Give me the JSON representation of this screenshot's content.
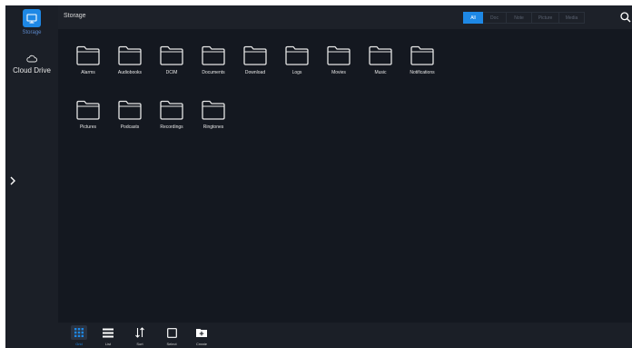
{
  "sidebar": {
    "items": [
      {
        "label": "Storage",
        "icon": "monitor-icon",
        "active": true
      },
      {
        "label": "Cloud Drive",
        "icon": "cloud-icon",
        "active": false
      }
    ],
    "expand_icon": "chevron-right-icon"
  },
  "header": {
    "title": "Storage",
    "filters": [
      "All",
      "Doc",
      "Note",
      "Picture",
      "Media"
    ],
    "active_filter": "All",
    "search_icon": "search-icon"
  },
  "folders": [
    {
      "name": "Alarms"
    },
    {
      "name": "Audiobooks"
    },
    {
      "name": "DCIM"
    },
    {
      "name": "Documents"
    },
    {
      "name": "Download"
    },
    {
      "name": "Logs"
    },
    {
      "name": "Movies"
    },
    {
      "name": "Music"
    },
    {
      "name": "Notifications"
    },
    {
      "name": "Pictures"
    },
    {
      "name": "Podcasts"
    },
    {
      "name": "Recordings"
    },
    {
      "name": "Ringtones"
    }
  ],
  "toolbar": {
    "items": [
      {
        "label": "Grid",
        "icon": "grid-icon",
        "active": true
      },
      {
        "label": "List",
        "icon": "list-icon",
        "active": false
      },
      {
        "label": "Sort",
        "icon": "sort-icon",
        "active": false
      },
      {
        "label": "Select",
        "icon": "select-icon",
        "active": false
      },
      {
        "label": "Create",
        "icon": "create-folder-icon",
        "active": false
      }
    ]
  },
  "colors": {
    "accent": "#1e88e5",
    "background": "#141820",
    "sidebar": "#1b1f27",
    "text": "#e6e6e6"
  }
}
